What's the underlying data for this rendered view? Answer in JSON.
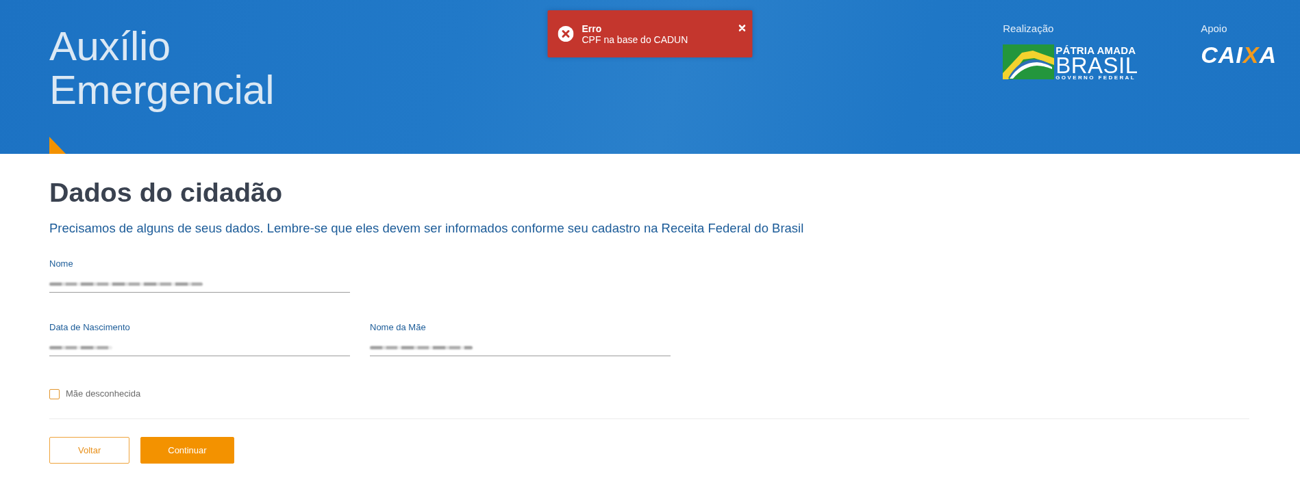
{
  "header": {
    "title": "Auxílio Emergencial",
    "sponsors": [
      {
        "kind": "patria",
        "label": "Realização",
        "logo_lines": [
          "PÁTRIA AMADA",
          "BRASIL",
          "GOVERNO FEDERAL"
        ]
      },
      {
        "kind": "caixa",
        "label": "Apoio",
        "logo_lines": [
          "CAIXA"
        ]
      }
    ]
  },
  "toast": {
    "kind": "error",
    "title": "Erro",
    "message": "CPF na base do CADUN"
  },
  "form": {
    "title": "Dados do cidadão",
    "intro": "Precisamos de alguns de seus dados. Lembre-se que eles devem ser informados conforme seu cadastro na Receita Federal do Brasil",
    "field_rows": [
      {
        "fields": [
          {
            "label": "Nome",
            "value_blurred": true
          }
        ]
      },
      {
        "fields": [
          {
            "label": "Data de Nascimento",
            "value_blurred": true
          },
          {
            "label": "Nome da Mãe",
            "value_blurred": true
          }
        ]
      }
    ],
    "checkbox": {
      "label": "Mãe desconhecida",
      "checked": false
    },
    "buttons": [
      {
        "kind": "secondary",
        "label": "Voltar"
      },
      {
        "kind": "primary",
        "label": "Continuar"
      }
    ]
  }
}
